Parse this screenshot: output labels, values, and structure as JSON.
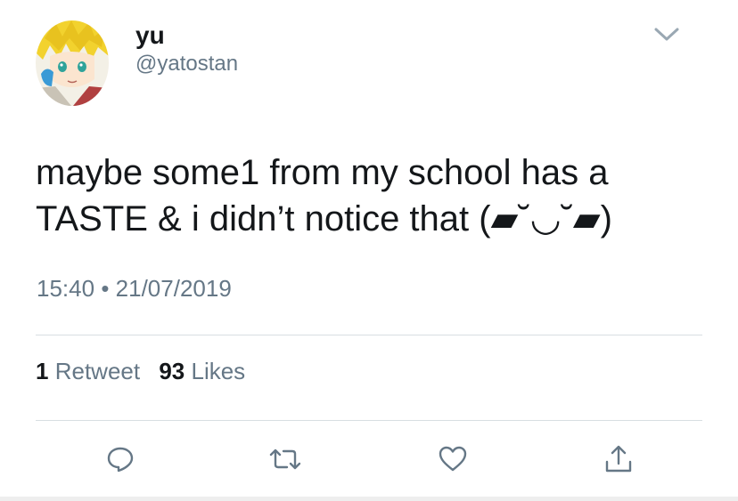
{
  "user": {
    "display_name": "yu",
    "handle": "@yatostan",
    "avatar": "anime-avatar"
  },
  "tweet": {
    "text_line1": "maybe some1 from my school has a",
    "text_line2": "TASTE & i didn’t notice that (▰˘◡˘▰)",
    "time": "15:40",
    "separator": "•",
    "date": "21/07/2019"
  },
  "stats": {
    "retweets_count": "1",
    "retweets_label": "Retweet",
    "likes_count": "93",
    "likes_label": "Likes"
  },
  "actions": [
    {
      "name": "reply",
      "icon": "reply-icon"
    },
    {
      "name": "retweet",
      "icon": "retweet-icon"
    },
    {
      "name": "like",
      "icon": "heart-icon"
    },
    {
      "name": "share",
      "icon": "share-icon"
    }
  ],
  "colors": {
    "text_primary": "#14171a",
    "text_secondary": "#657786",
    "divider": "#d8dee2",
    "icon": "#657786"
  }
}
